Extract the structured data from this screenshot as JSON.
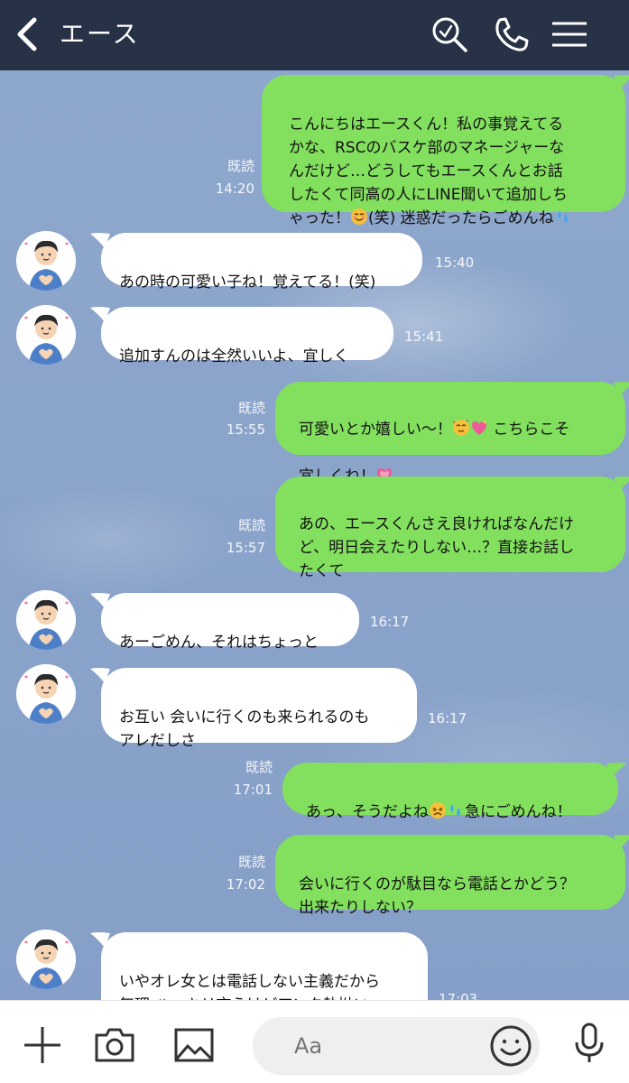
{
  "header": {
    "title": "エース",
    "back_icon": "back-chevron-icon",
    "search_icon": "search-icon",
    "call_icon": "phone-icon",
    "menu_icon": "menu-icon"
  },
  "messages": [
    {
      "dir": "out",
      "text": "こんにちはエースくん！私の事覚えてる\nかな、RSCのバスケ部のマネージャーな\nんだけど…どうしてもエースくんとお話\nしたくて同高の人にLINE聞いて追加しち\nゃった！",
      "text2": "(笑) 迷惑だったらごめんね",
      "read": "既読",
      "time": "14:20"
    },
    {
      "dir": "in",
      "text": "あの時の可愛い子ね！覚えてる！(笑)",
      "time": "15:40"
    },
    {
      "dir": "in",
      "text": "追加すんのは全然いいよ、宜しく",
      "time": "15:41"
    },
    {
      "dir": "out",
      "text": "可愛いとか嬉しい〜！",
      "text2": " こちらこそ",
      "text3": "宜しくね！",
      "read": "既読",
      "time": "15:55"
    },
    {
      "dir": "out",
      "text": "あの、エースくんさえ良ければなんだけ\nど、明日会えたりしない…？直接お話し\nたくて",
      "read": "既読",
      "time": "15:57"
    },
    {
      "dir": "in",
      "text": "あーごめん、それはちょっと",
      "time": "16:17"
    },
    {
      "dir": "in",
      "text": "お互い 会いに行くのも来られるのも\nアレだしさ",
      "time": "16:17"
    },
    {
      "dir": "out",
      "text": "あっ、そうだよね",
      "text2": "急にごめんね！",
      "read": "既読",
      "time": "17:01"
    },
    {
      "dir": "out",
      "text": "会いに行くのが駄目なら電話とかどう？\n出来たりしない？",
      "read": "既読",
      "time": "17:02"
    },
    {
      "dir": "in",
      "text": "いやオレ女とは電話しない主義だから\n無理  ハッキリ言うけどアンタ執拗い\nよ(笑)",
      "time": "17:03"
    }
  ],
  "colors": {
    "header_bg": "#273246",
    "chat_bg": "#8aa4cb",
    "out_bubble": "#83e05f",
    "in_bubble": "#ffffff"
  },
  "toolbar": {
    "plus_icon": "plus-icon",
    "camera_icon": "camera-icon",
    "image_icon": "image-icon",
    "input_placeholder": "Aa",
    "emoji_icon": "smiley-icon",
    "mic_icon": "microphone-icon"
  }
}
